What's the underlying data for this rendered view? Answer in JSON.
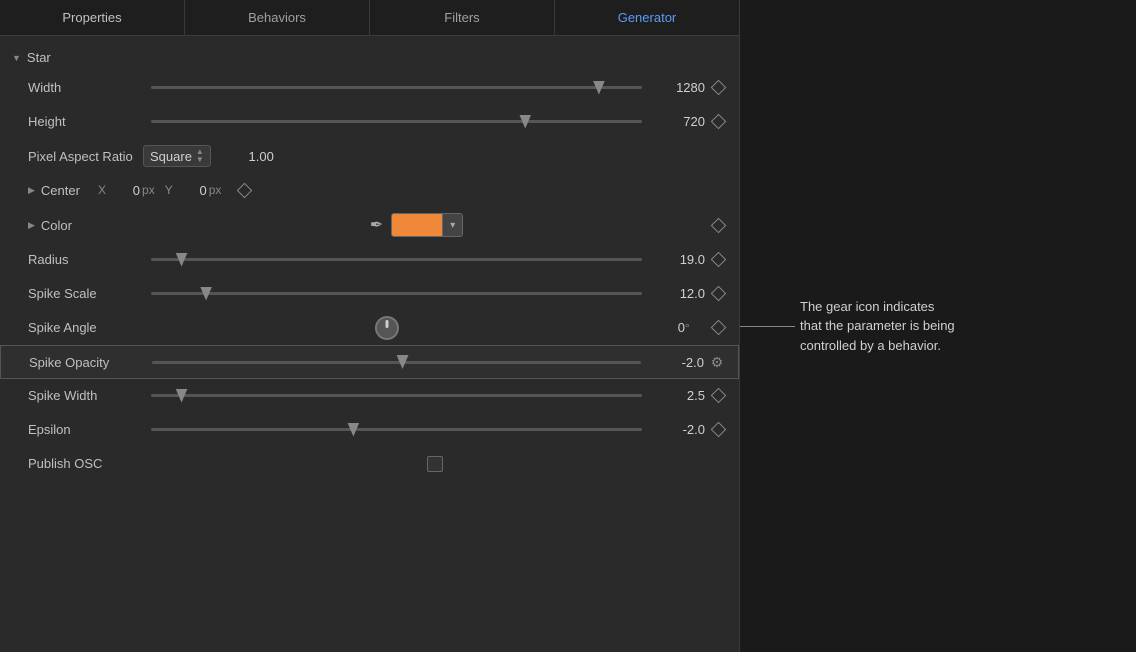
{
  "tabs": [
    {
      "id": "properties",
      "label": "Properties",
      "active": false
    },
    {
      "id": "behaviors",
      "label": "Behaviors",
      "active": false
    },
    {
      "id": "filters",
      "label": "Filters",
      "active": false
    },
    {
      "id": "generator",
      "label": "Generator",
      "active": true
    }
  ],
  "section": {
    "name": "Star",
    "triangle": "▼"
  },
  "properties": [
    {
      "id": "width",
      "label": "Width",
      "value": "1280",
      "unit": "",
      "hasSlider": true,
      "thumbPos": 95,
      "thumbType": "down",
      "hasDiamond": true
    },
    {
      "id": "height",
      "label": "Height",
      "value": "720",
      "unit": "",
      "hasSlider": true,
      "thumbPos": 75,
      "thumbType": "down",
      "hasDiamond": true
    },
    {
      "id": "radius",
      "label": "Radius",
      "value": "19.0",
      "unit": "",
      "hasSlider": true,
      "thumbPos": 5,
      "thumbType": "down",
      "hasDiamond": true
    },
    {
      "id": "spike-scale",
      "label": "Spike Scale",
      "value": "12.0",
      "unit": "",
      "hasSlider": true,
      "thumbPos": 10,
      "thumbType": "down",
      "hasDiamond": true
    },
    {
      "id": "spike-angle",
      "label": "Spike Angle",
      "value": "0",
      "unit": "°",
      "hasDial": true,
      "hasDiamond": true
    },
    {
      "id": "spike-opacity",
      "label": "Spike Opacity",
      "value": "-2.0",
      "unit": "",
      "hasSlider": true,
      "thumbPos": 50,
      "thumbType": "down",
      "hasGear": true,
      "highlighted": true
    },
    {
      "id": "spike-width",
      "label": "Spike Width",
      "value": "2.5",
      "unit": "",
      "hasSlider": true,
      "thumbPos": 5,
      "thumbType": "down",
      "hasDiamond": true
    },
    {
      "id": "epsilon",
      "label": "Epsilon",
      "value": "-2.0",
      "unit": "",
      "hasSlider": true,
      "thumbPos": 40,
      "thumbType": "down",
      "hasDiamond": true
    }
  ],
  "pixel_aspect_ratio": {
    "label": "Pixel Aspect Ratio",
    "dropdown_value": "Square",
    "value": "1.00"
  },
  "center": {
    "label": "Center",
    "triangle": "▶",
    "x_label": "X",
    "x_value": "0",
    "x_unit": "px",
    "y_label": "Y",
    "y_value": "0",
    "y_unit": "px"
  },
  "color": {
    "label": "Color",
    "triangle": "▶",
    "swatch_color": "#f0883a"
  },
  "publish_osc": {
    "label": "Publish OSC"
  },
  "annotation": {
    "text": "The gear icon indicates\nthat the parameter is being\ncontrolled by a behavior."
  },
  "icons": {
    "triangle_down": "▼",
    "triangle_right": "▶",
    "chevron_down": "⌄",
    "eyedropper": "✒",
    "gear": "⚙"
  }
}
